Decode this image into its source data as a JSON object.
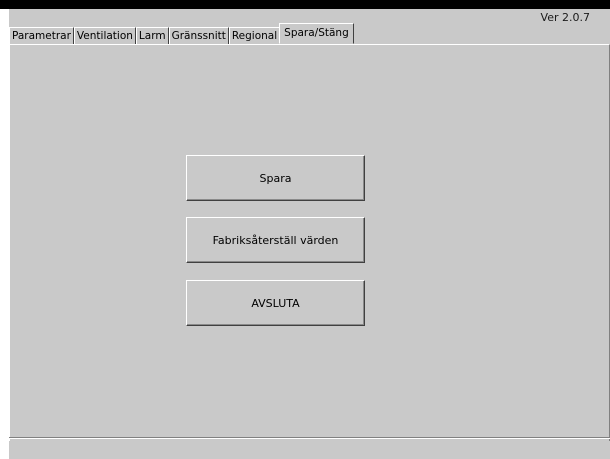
{
  "version": "Ver 2.0.7",
  "tabs": [
    {
      "label": "Parametrar",
      "active": false
    },
    {
      "label": "Ventilation",
      "active": false
    },
    {
      "label": "Larm",
      "active": false
    },
    {
      "label": "Gränssnitt",
      "active": false
    },
    {
      "label": "Regional",
      "active": false
    },
    {
      "label": "Spara/Stäng",
      "active": true
    }
  ],
  "buttons": {
    "save": "Spara",
    "factory_reset": "Fabriksåterställ värden",
    "exit": "AVSLUTA"
  },
  "colors": {
    "background": "#c9c9c9",
    "top_bar": "#000000"
  }
}
